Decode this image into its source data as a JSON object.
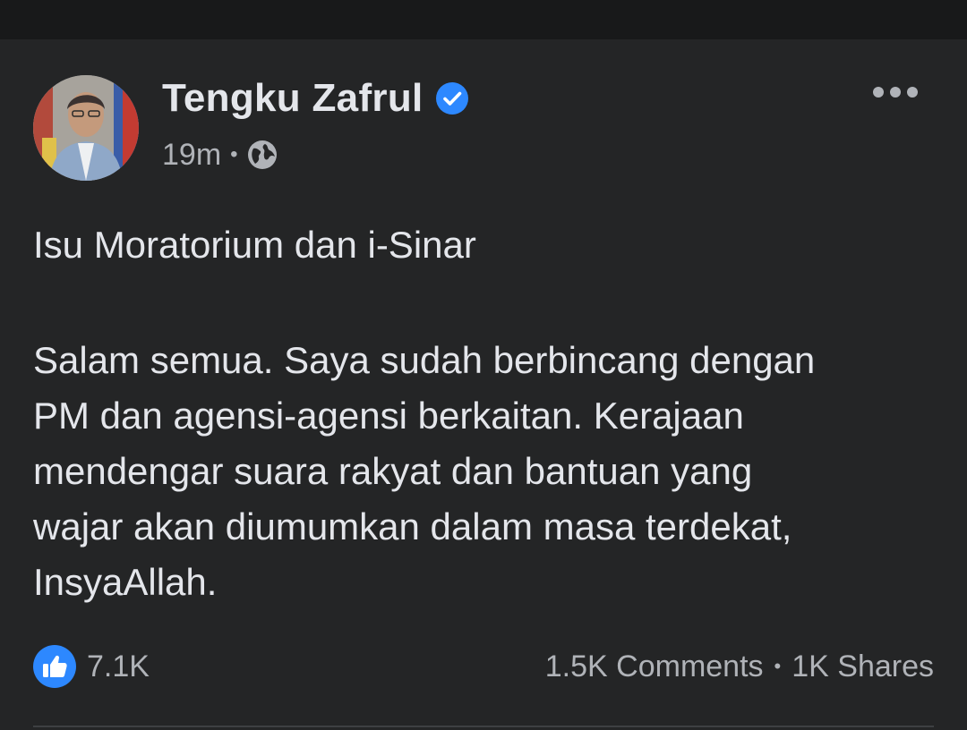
{
  "post": {
    "author": {
      "name": "Tengku Zafrul",
      "verified": true
    },
    "time": "19m",
    "audience_icon": "globe-icon",
    "title": "Isu Moratorium dan i-Sinar",
    "body_lines": [
      "Salam semua. Saya sudah berbincang dengan",
      "PM dan agensi-agensi berkaitan. Kerajaan",
      "mendengar suara rakyat dan bantuan yang",
      "wajar akan diumumkan dalam masa terdekat,",
      "InsyaAllah."
    ],
    "meta_separator": "•",
    "reactions": {
      "icon": "like-icon",
      "count": "7.1K"
    },
    "comments": "1.5K Comments",
    "stats_separator": "•",
    "shares": "1K Shares"
  },
  "colors": {
    "background": "#242526",
    "topbar": "#18191a",
    "primary_text": "#e4e6eb",
    "secondary_text": "#b0b3b8",
    "accent_blue": "#2d88ff"
  }
}
